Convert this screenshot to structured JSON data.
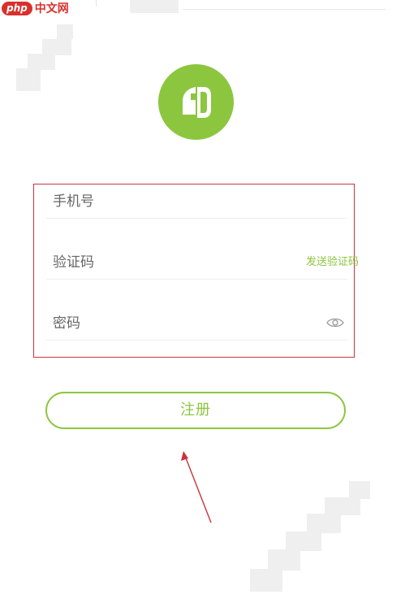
{
  "watermark": {
    "badge": "php",
    "text": "中文网"
  },
  "logo": {
    "icon": "app-logo-icon",
    "color": "#8cc63f"
  },
  "form": {
    "phone_label": "手机号",
    "code_label": "验证码",
    "send_code": "发送验证码",
    "password_label": "密码",
    "password_toggle_icon": "eye-icon"
  },
  "register": {
    "label": "注册"
  },
  "colors": {
    "accent": "#8cc63f",
    "highlight_border": "#c9343b",
    "annotation": "#c9343b"
  }
}
